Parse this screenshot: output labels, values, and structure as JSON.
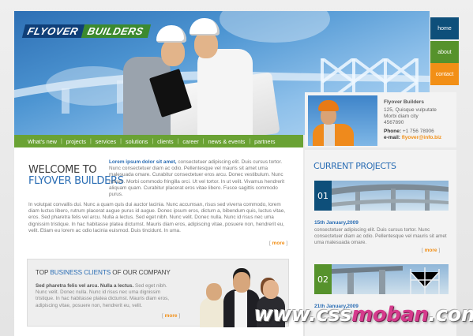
{
  "brand": {
    "word1": "FLYOVER",
    "word2": "BUILDERS"
  },
  "top_nav": [
    {
      "label": "home",
      "color": "#0e4f7a"
    },
    {
      "label": "about",
      "color": "#56922c"
    },
    {
      "label": "contact",
      "color": "#f28f16"
    }
  ],
  "main_nav": [
    "What's new",
    "projects",
    "services",
    "solutions",
    "clients",
    "career",
    "news & events",
    "partners"
  ],
  "contact": {
    "name": "Flyover Builders",
    "address": [
      "125, Quisque vulputate",
      "Morbi diam city",
      "4567890"
    ],
    "phone_label": "Phone:",
    "phone": "+1 756 78906",
    "email_label": "e-mail:",
    "email": "flyover@info.biz"
  },
  "welcome": {
    "line1": "WELCOME TO",
    "line2": "FLYOVER BUILDERS"
  },
  "intro": {
    "lead": "Lorem ipsum dolor sit amet,",
    "text": " consectetuer adipiscing elit. Duis cursus tortor. Nunc consectetuer diam ac odio. Pellentesque vel mauris sit amet uma malesuada omare. Curabitur consectetuer eros arcu. Donec vestibulum. Nunc rutrum. Morbi commodo fringilla orci. Ut vel tortor. In ut velit. Vivamus hendrerit aliquam quam. Curabitur placerat eros vitae libero. Fusce sagittis commodo purus."
  },
  "paragraph2": "In volutpat convallis dui. Nunc a quam quis dui auctor lacinia. Nunc accumsan, risus sed viverra commodo, lorem diam luctus libero, rutrum placerat augue purus id augue. Donec ipsum eros, dictum a, bibendum quis, luctus vitae, eros. Sed pharetra felis vel arcu. Nulla a lectus. Sed eget nibh. Nunc velit. Donec nulla. Nunc id risus nec uma dignissim tristique. In hac habitasse platea dictumst. Mauris diam eros, adipiscing vitae, posuere non, hendrerit eu, velit. Etiam eu lorem ac odio lacinia euismod. Duis tincidunt. In uma.",
  "more_label": "more",
  "clients": {
    "title_pre": "TOP ",
    "title_mid": "BUSINESS CLIENTS",
    "title_post": " OF OUR COMPANY",
    "lead": "Sed pharetra felis vel arcu. Nulla a lectus.",
    "text": " Sed eget nibh. Nunc velit. Donec nulla. Nunc id risus nec uma dignissim tristique. In hac habitasse platea dictumst. Mauris diam eros, adipiscing vitae, posuere non, hendrerit eu, velit."
  },
  "projects": {
    "title": "CURRENT PROJECTS",
    "items": [
      {
        "num": "01",
        "date": "15th January,2009",
        "desc": "consectetuer adipiscing elit. Duis cursus tortor. Nunc consectetuer diam ac odio. Pellentesque vel mauris sit amet uma malesuada omare."
      },
      {
        "num": "02",
        "date": "21th January,2009"
      }
    ]
  },
  "watermark": {
    "a": "www.css",
    "b": "moban",
    "c": ".com"
  }
}
